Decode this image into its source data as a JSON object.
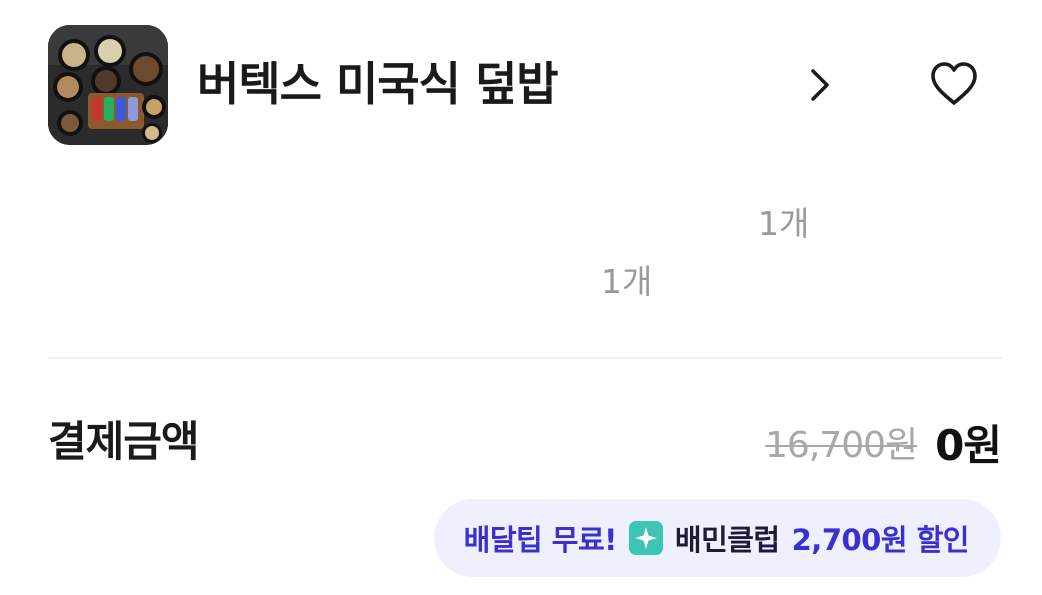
{
  "store": {
    "name": "버텍스 미국식 덮밥",
    "thumbnail_icon": "food-photo-thumbnail",
    "chevron_icon": "chevron-right-icon",
    "favorite_icon": "heart-outline-icon"
  },
  "items": [
    {
      "quantity": "1개"
    },
    {
      "quantity": "1개"
    }
  ],
  "payment": {
    "label": "결제금액",
    "original_price": "16,700원",
    "final_price": "0원"
  },
  "promo": {
    "delivery_text": "배달팁 무료!",
    "club_icon": "sparkle-badge-icon",
    "club_name": "배민클럽",
    "discount_text": "2,700원 할인",
    "colors": {
      "background": "#eef0fd",
      "accent": "#3a2fd0",
      "badge": "#3cc5b4"
    }
  }
}
